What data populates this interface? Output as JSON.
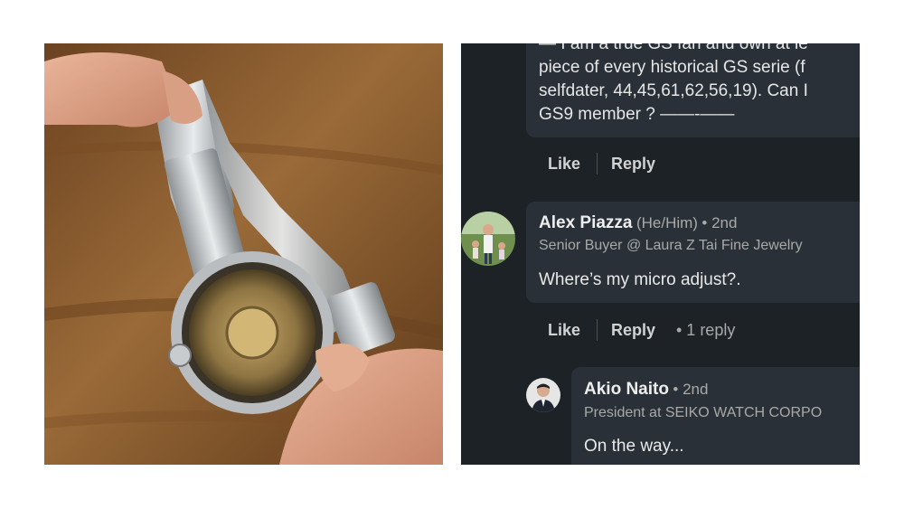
{
  "post_comment": {
    "lines": [
      "— I am a true GS fan and own at le",
      "piece of every historical GS serie (f",
      "selfdater, 44,45,61,62,56,19). Can I",
      "GS9 member ? ——-——"
    ],
    "like_label": "Like",
    "reply_label": "Reply"
  },
  "comment_1": {
    "name": "Alex Piazza",
    "pronouns": "(He/Him)",
    "degree": "• 2nd",
    "headline": "Senior Buyer @ Laura Z Tai Fine Jewelry",
    "text": "Where’s my micro adjust?.",
    "like_label": "Like",
    "reply_label": "Reply",
    "replies": "•  1 reply"
  },
  "comment_2": {
    "name": "Akio Naito",
    "degree": "• 2nd",
    "headline": "President at SEIKO WATCH CORPO",
    "text": "On the way..."
  },
  "colors": {
    "panel_bg": "#1d2226",
    "bubble_bg": "#293037",
    "photo_wood": "#8a5a2b"
  }
}
